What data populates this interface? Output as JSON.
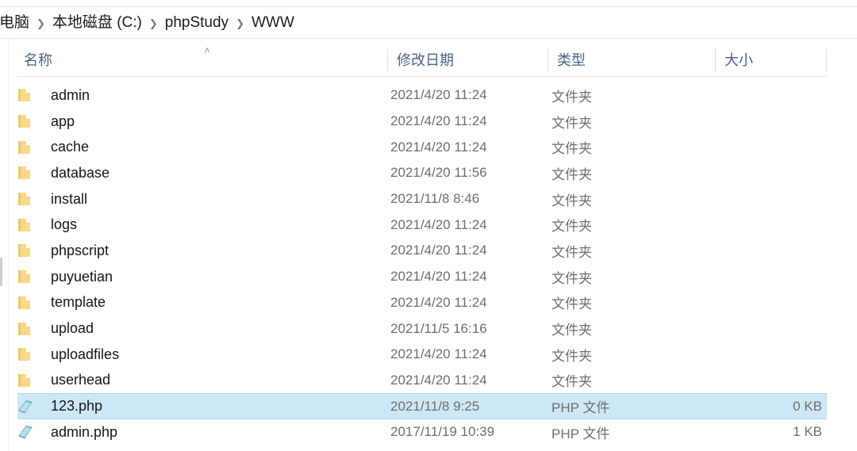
{
  "window": {
    "app": "file-explorer"
  },
  "breadcrumb": {
    "separator": "❯",
    "items": [
      {
        "label": "电脑"
      },
      {
        "label": "本地磁盘 (C:)"
      },
      {
        "label": "phpStudy"
      },
      {
        "label": "WWW"
      }
    ]
  },
  "columns": {
    "name": "名称",
    "date": "修改日期",
    "type": "类型",
    "size": "大小",
    "sort_indicator": "˄"
  },
  "colors": {
    "selection_fill": "#cce8f7",
    "selection_border": "#a8d8ee",
    "header_text": "#4a6486",
    "folder_yellow": "#f6d98a",
    "php_blue": "#9cd2e8"
  },
  "files": [
    {
      "name": "admin",
      "icon": "folder-icon",
      "date": "2021/4/20 11:24",
      "type": "文件夹",
      "size": "",
      "selected": false
    },
    {
      "name": "app",
      "icon": "folder-icon",
      "date": "2021/4/20 11:24",
      "type": "文件夹",
      "size": "",
      "selected": false
    },
    {
      "name": "cache",
      "icon": "folder-icon",
      "date": "2021/4/20 11:24",
      "type": "文件夹",
      "size": "",
      "selected": false
    },
    {
      "name": "database",
      "icon": "folder-icon",
      "date": "2021/4/20 11:56",
      "type": "文件夹",
      "size": "",
      "selected": false
    },
    {
      "name": "install",
      "icon": "folder-icon",
      "date": "2021/11/8 8:46",
      "type": "文件夹",
      "size": "",
      "selected": false
    },
    {
      "name": "logs",
      "icon": "folder-icon",
      "date": "2021/4/20 11:24",
      "type": "文件夹",
      "size": "",
      "selected": false
    },
    {
      "name": "phpscript",
      "icon": "folder-icon",
      "date": "2021/4/20 11:24",
      "type": "文件夹",
      "size": "",
      "selected": false
    },
    {
      "name": "puyuetian",
      "icon": "folder-icon",
      "date": "2021/4/20 11:24",
      "type": "文件夹",
      "size": "",
      "selected": false
    },
    {
      "name": "template",
      "icon": "folder-icon",
      "date": "2021/4/20 11:24",
      "type": "文件夹",
      "size": "",
      "selected": false
    },
    {
      "name": "upload",
      "icon": "folder-icon",
      "date": "2021/11/5 16:16",
      "type": "文件夹",
      "size": "",
      "selected": false
    },
    {
      "name": "uploadfiles",
      "icon": "folder-icon",
      "date": "2021/4/20 11:24",
      "type": "文件夹",
      "size": "",
      "selected": false
    },
    {
      "name": "userhead",
      "icon": "folder-icon",
      "date": "2021/4/20 11:24",
      "type": "文件夹",
      "size": "",
      "selected": false
    },
    {
      "name": "123.php",
      "icon": "php-file-icon",
      "date": "2021/11/8 9:25",
      "type": "PHP 文件",
      "size": "0 KB",
      "selected": true
    },
    {
      "name": "admin.php",
      "icon": "php-file-icon",
      "date": "2017/11/19 10:39",
      "type": "PHP 文件",
      "size": "1 KB",
      "selected": false
    }
  ]
}
